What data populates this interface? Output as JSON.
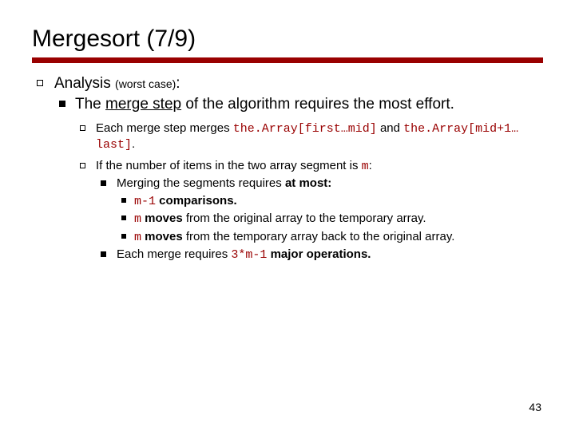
{
  "title": "Mergesort (7/9)",
  "l0_label": "Analysis ",
  "l0_sub": "(worst case)",
  "l0_tail": ":",
  "l1_pre": "The ",
  "l1_u": "merge step",
  "l1_post": " of the algorithm requires the most effort.",
  "l2a_pre": "Each merge step merges ",
  "l2a_code1": "the.Array[first…mid]",
  "l2a_mid": " and ",
  "l2a_code2": "the.Array[mid+1…last]",
  "l2a_post": ".",
  "l2b_pre": "If the number of items in the two array segment is ",
  "l2b_code": "m",
  "l2b_post": ":",
  "l3a_pre": "Merging the segments requires ",
  "l3a_b": "at most:",
  "l4a_code": "m-1",
  "l4a_b": " comparisons.",
  "l4b_code": "m",
  "l4b_b": " moves",
  "l4b_post": " from the original array to the temporary array.",
  "l4c_code": "m",
  "l4c_b": " moves",
  "l4c_post": " from the temporary array back to the original array.",
  "l3b_pre": "Each merge requires ",
  "l3b_code": "3*m-1",
  "l3b_b": " major operations.",
  "pagenum": "43"
}
